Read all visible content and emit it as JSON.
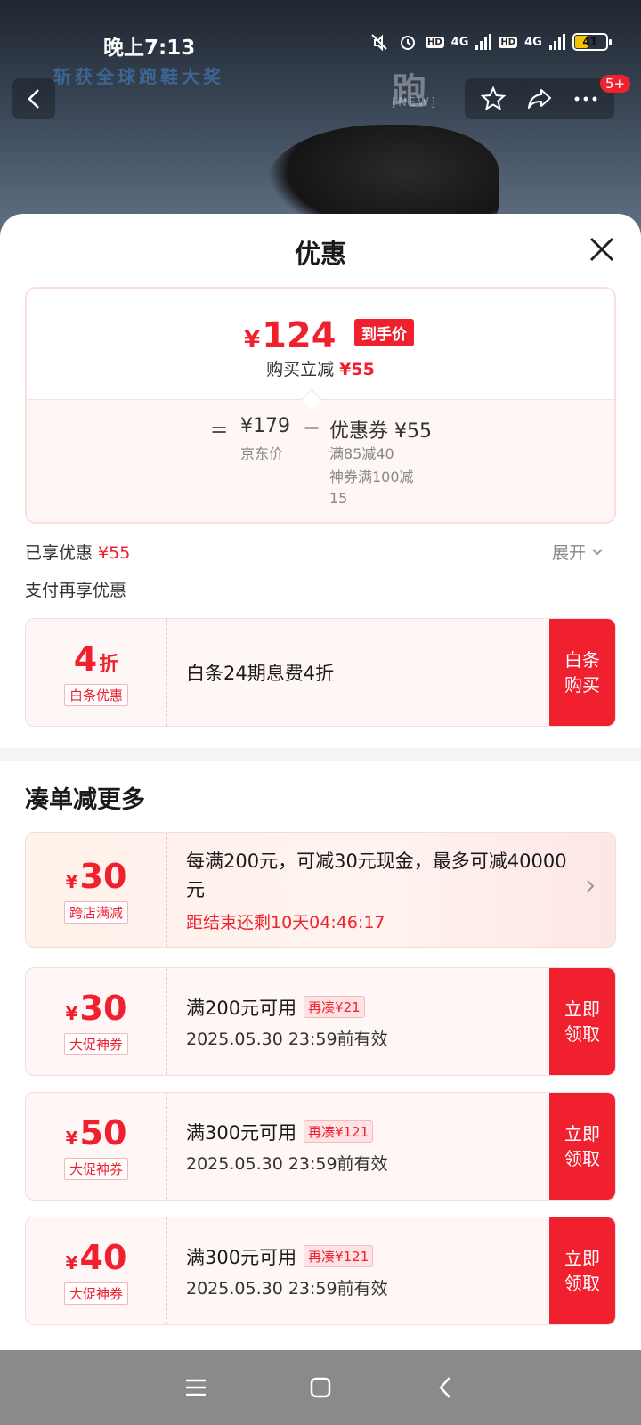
{
  "status_bar": {
    "time": "晚上7:13",
    "network1": "4G",
    "network2": "4G",
    "hd": "HD",
    "battery": "41"
  },
  "hero": {
    "brand_line": "斩获全球跑鞋大奖",
    "badge_count": "5+"
  },
  "sheet": {
    "title": "优惠",
    "price_card": {
      "currency": "¥",
      "final_price": "124",
      "final_tag": "到手价",
      "buy_reduce_label": "购买立减",
      "buy_reduce_value": "¥55",
      "equals": "=",
      "jd_price": "¥179",
      "jd_label": "京东价",
      "minus": "−",
      "coupon_total": "优惠券 ¥55",
      "coupon_detail_1": "满85减40",
      "coupon_detail_2": "神券满100减15"
    },
    "enjoyed_label": "已享优惠",
    "enjoyed_value": "¥55",
    "expand_label": "展开",
    "pay_more_label": "支付再享优惠",
    "baitiao": {
      "amount": "4",
      "unit": "折",
      "tag": "白条优惠",
      "title": "白条24期息费4折",
      "cta": "白条购买"
    },
    "more_title": "凑单减更多",
    "promo": {
      "currency": "¥",
      "amount": "30",
      "tag": "跨店满减",
      "line": "每满200元，可减30元现金，最多可减40000元",
      "timer": "距结束还剩10天04:46:17"
    },
    "coupons": [
      {
        "currency": "¥",
        "amount": "30",
        "tag": "大促神券",
        "title": "满200元可用",
        "extra": "再凑¥21",
        "expiry": "2025.05.30 23:59前有效",
        "cta": "立即领取"
      },
      {
        "currency": "¥",
        "amount": "50",
        "tag": "大促神券",
        "title": "满300元可用",
        "extra": "再凑¥121",
        "expiry": "2025.05.30 23:59前有效",
        "cta": "立即领取"
      },
      {
        "currency": "¥",
        "amount": "40",
        "tag": "大促神券",
        "title": "满300元可用",
        "extra": "再凑¥121",
        "expiry": "2025.05.30 23:59前有效",
        "cta": "立即领取"
      }
    ]
  },
  "icons": {
    "back": "chevron-left-icon",
    "star": "star-icon",
    "share": "share-icon",
    "more": "more-icon",
    "close": "close-icon",
    "expand": "chevron-down-icon",
    "nav_menu": "menu-icon",
    "nav_home": "home-icon",
    "nav_back": "back-icon"
  },
  "colors": {
    "accent": "#f0202f",
    "card_bg": "#fff6f6"
  }
}
